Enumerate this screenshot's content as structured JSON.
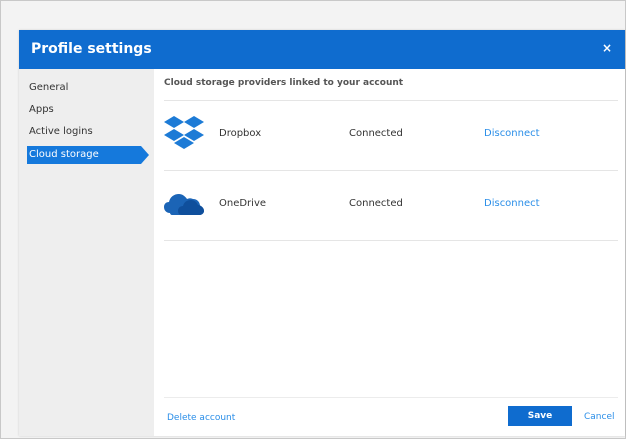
{
  "dialog": {
    "title": "Profile settings",
    "close_label": "×"
  },
  "sidebar": {
    "items": [
      {
        "label": "General",
        "active": false
      },
      {
        "label": "Apps",
        "active": false
      },
      {
        "label": "Active logins",
        "active": false
      },
      {
        "label": "Cloud storage",
        "active": true
      }
    ]
  },
  "main": {
    "heading": "Cloud storage providers linked to your account",
    "providers": [
      {
        "name": "Dropbox",
        "status": "Connected",
        "action": "Disconnect",
        "icon": "dropbox-icon"
      },
      {
        "name": "OneDrive",
        "status": "Connected",
        "action": "Disconnect",
        "icon": "onedrive-icon"
      }
    ]
  },
  "footer": {
    "delete_label": "Delete account",
    "save_label": "Save",
    "cancel_label": "Cancel"
  },
  "colors": {
    "accent": "#0f6ccf",
    "link": "#2a8ee8",
    "sidebar_bg": "#eeeeee"
  }
}
